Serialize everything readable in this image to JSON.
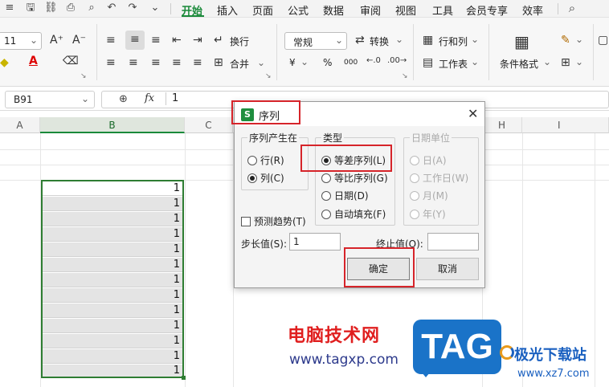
{
  "menubar": {
    "items": [
      "开始",
      "插入",
      "页面",
      "公式",
      "数据",
      "审阅",
      "视图",
      "工具",
      "会员专享",
      "效率"
    ],
    "active_index": 0
  },
  "ribbon": {
    "font_size": "11",
    "align_wrap_label": "换行",
    "merge_label": "合并",
    "number_format": "常规",
    "convert_label": "转换",
    "rows_cols_label": "行和列",
    "worksheet_label": "工作表",
    "cond_format_label": "条件格式",
    "currency_symbol": "¥",
    "percent_symbol": "%",
    "thousands_symbol": "000"
  },
  "formula_bar": {
    "name_box": "B91",
    "fx_label": "fx",
    "value": "1"
  },
  "columns": [
    "A",
    "B",
    "C",
    "H",
    "I"
  ],
  "cells": [
    "1",
    "1",
    "1",
    "1",
    "1",
    "1",
    "1",
    "1",
    "1",
    "1",
    "1",
    "1",
    "1"
  ],
  "dialog": {
    "title": "序列",
    "logo_letter": "S",
    "group_series_in": {
      "label": "序列产生在",
      "options": [
        "行(R)",
        "列(C)"
      ],
      "selected": 1
    },
    "group_type": {
      "label": "类型",
      "options": [
        "等差序列(L)",
        "等比序列(G)",
        "日期(D)",
        "自动填充(F)"
      ],
      "selected": 0
    },
    "group_date_unit": {
      "label": "日期单位",
      "options": [
        "日(A)",
        "工作日(W)",
        "月(M)",
        "年(Y)"
      ]
    },
    "trend_label": "预测趋势(T)",
    "step_label": "步长值(S):",
    "step_value": "1",
    "stop_label": "终止值(O):",
    "stop_value": "",
    "ok_label": "确定",
    "cancel_label": "取消"
  },
  "watermark": {
    "text": "电脑技术网",
    "url": "www.tagxp.com",
    "badge": "TAG",
    "site": "极光下载站",
    "site_url": "www.xz7.com"
  },
  "colors": {
    "accent_green": "#1a8a3a",
    "highlight_red": "#d6242a",
    "selection_border": "#2e7d32"
  }
}
